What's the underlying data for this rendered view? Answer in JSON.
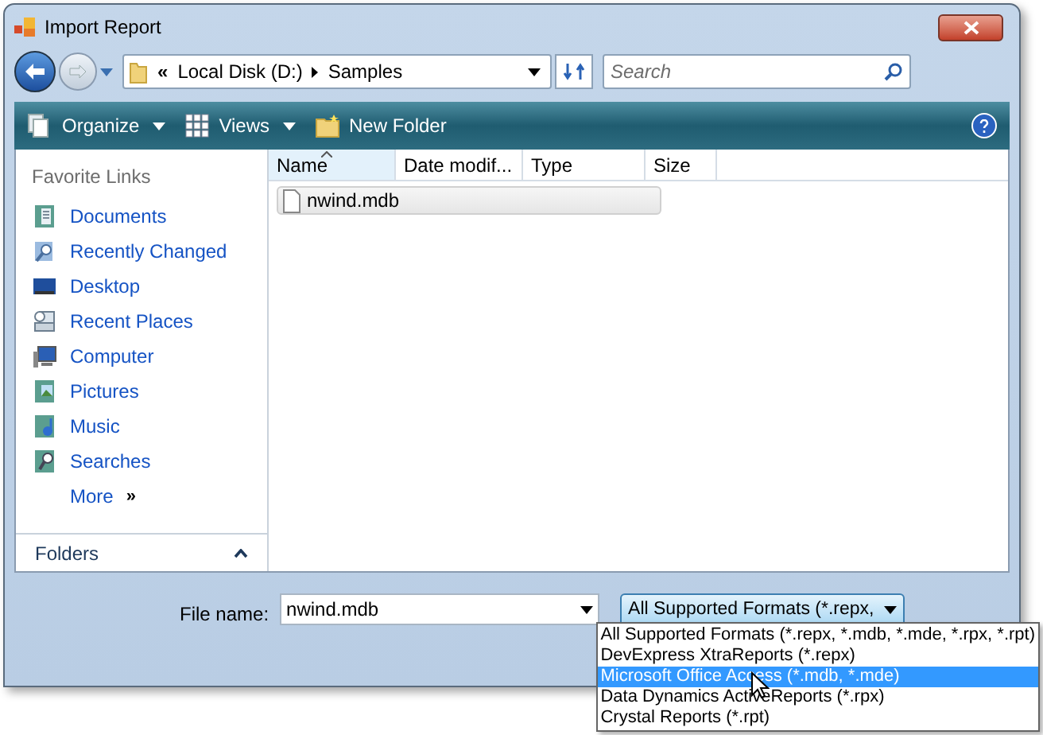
{
  "window": {
    "title": "Import Report"
  },
  "address": {
    "overflow_mark": "«",
    "segments": [
      "Local Disk (D:)",
      "Samples"
    ]
  },
  "search": {
    "placeholder": "Search"
  },
  "toolbar": [
    {
      "label": "Organize",
      "kind": "organize"
    },
    {
      "label": "Views",
      "kind": "views"
    },
    {
      "label": "New Folder",
      "kind": "new-folder"
    }
  ],
  "favorite_links": {
    "title": "Favorite Links",
    "items": [
      {
        "label": "Documents",
        "kind": "documents"
      },
      {
        "label": "Recently Changed",
        "kind": "recent"
      },
      {
        "label": "Desktop",
        "kind": "desktop"
      },
      {
        "label": "Recent Places",
        "kind": "places"
      },
      {
        "label": "Computer",
        "kind": "computer"
      },
      {
        "label": "Pictures",
        "kind": "pictures"
      },
      {
        "label": "Music",
        "kind": "music"
      },
      {
        "label": "Searches",
        "kind": "searches"
      }
    ],
    "more": {
      "label": "More",
      "mark": "»"
    }
  },
  "folders": {
    "label": "Folders",
    "expanded": false
  },
  "columns": [
    {
      "label": "Name",
      "sorted": true
    },
    {
      "label": "Date modif...",
      "sorted": false
    },
    {
      "label": "Type",
      "sorted": false
    },
    {
      "label": "Size",
      "sorted": false
    }
  ],
  "files": [
    {
      "name": "nwind.mdb",
      "selected": true
    }
  ],
  "file_name": {
    "label": "File name:",
    "value": "nwind.mdb"
  },
  "file_type": {
    "value": "All Supported Formats (*.repx,",
    "expanded": true,
    "options": [
      {
        "label": "All Supported Formats (*.repx, *.mdb, *.mde, *.rpx, *.rpt)",
        "selected": false
      },
      {
        "label": "DevExpress XtraReports (*.repx)",
        "selected": false
      },
      {
        "label": "Microsoft Office Access (*.mdb, *.mde)",
        "selected": true
      },
      {
        "label": "Data Dynamics ActiveReports (*.rpx)",
        "selected": false
      },
      {
        "label": "Crystal Reports (*.rpt)",
        "selected": false
      }
    ]
  }
}
